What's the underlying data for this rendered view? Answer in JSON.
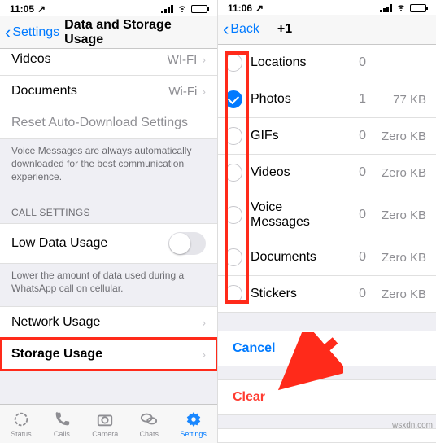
{
  "left": {
    "status": {
      "time": "11:05",
      "carrier_arrow": "↗"
    },
    "nav": {
      "back": "Settings",
      "title": "Data and Storage Usage"
    },
    "rows": {
      "videos": {
        "label": "Videos",
        "value": "WI-FI"
      },
      "documents": {
        "label": "Documents",
        "value": "Wi-Fi"
      },
      "reset": {
        "label": "Reset Auto-Download Settings"
      }
    },
    "voice_note": "Voice Messages are always automatically downloaded for the best communication experience.",
    "call_header": "CALL SETTINGS",
    "low_data": {
      "label": "Low Data Usage"
    },
    "low_data_note": "Lower the amount of data used during a WhatsApp call on cellular.",
    "network_usage": {
      "label": "Network Usage"
    },
    "storage_usage": {
      "label": "Storage Usage"
    },
    "tabs": [
      "Status",
      "Calls",
      "Camera",
      "Chats",
      "Settings"
    ]
  },
  "right": {
    "status": {
      "time": "11:06",
      "carrier_arrow": "↗"
    },
    "nav": {
      "back": "Back",
      "title": "+1"
    },
    "items": [
      {
        "label": "Locations",
        "count": "0",
        "size": "",
        "checked": false
      },
      {
        "label": "Photos",
        "count": "1",
        "size": "77 KB",
        "checked": true
      },
      {
        "label": "GIFs",
        "count": "0",
        "size": "Zero KB",
        "checked": false
      },
      {
        "label": "Videos",
        "count": "0",
        "size": "Zero KB",
        "checked": false
      },
      {
        "label": "Voice Messages",
        "count": "0",
        "size": "Zero KB",
        "checked": false
      },
      {
        "label": "Documents",
        "count": "0",
        "size": "Zero KB",
        "checked": false
      },
      {
        "label": "Stickers",
        "count": "0",
        "size": "Zero KB",
        "checked": false
      }
    ],
    "actions": {
      "cancel": "Cancel",
      "clear": "Clear"
    }
  },
  "watermark": "wsxdn.com"
}
